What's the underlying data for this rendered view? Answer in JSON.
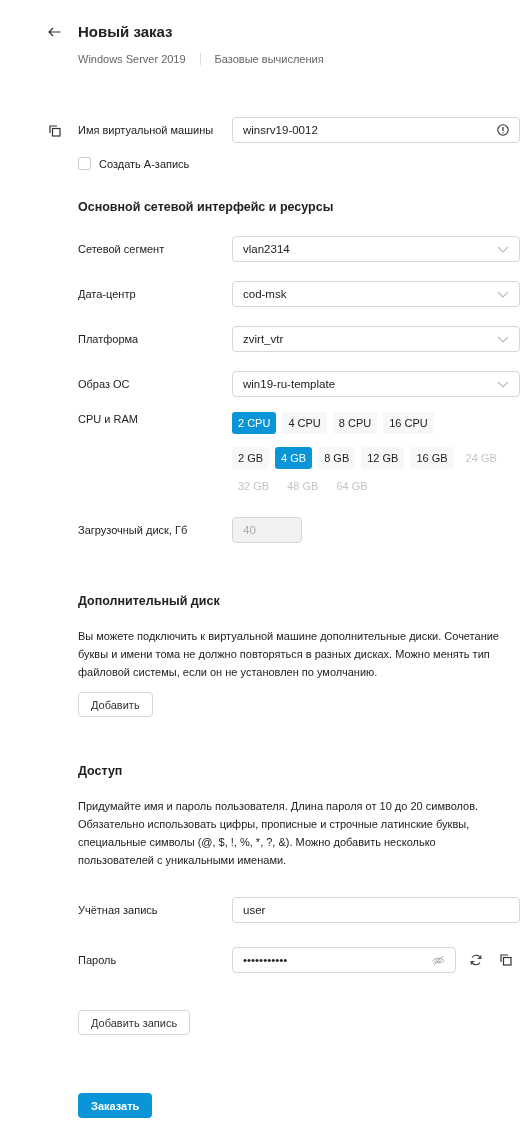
{
  "header": {
    "title": "Новый заказ",
    "subtitle": [
      "Windows Server 2019",
      "Базовые вычисления"
    ]
  },
  "vm_name": {
    "label": "Имя виртуальной машины",
    "value": "winsrv19-0012"
  },
  "a_record": {
    "label": "Создать А-запись",
    "checked": false
  },
  "network": {
    "heading": "Основной сетевой интерфейс и ресурсы",
    "selects": [
      {
        "label": "Сетевой сегмент",
        "value": "vlan2314"
      },
      {
        "label": "Дата-центр",
        "value": "cod-msk"
      },
      {
        "label": "Платформа",
        "value": "zvirt_vtr"
      },
      {
        "label": "Образ ОС",
        "value": "win19-ru-template"
      }
    ],
    "cpu_ram": {
      "label": "CPU и RAM",
      "cpu": [
        {
          "label": "2 CPU",
          "selected": true,
          "disabled": false
        },
        {
          "label": "4 CPU",
          "selected": false,
          "disabled": false
        },
        {
          "label": "8 CPU",
          "selected": false,
          "disabled": false
        },
        {
          "label": "16 CPU",
          "selected": false,
          "disabled": false
        }
      ],
      "ram": [
        {
          "label": "2 GB",
          "selected": false,
          "disabled": false
        },
        {
          "label": "4 GB",
          "selected": true,
          "disabled": false
        },
        {
          "label": "8 GB",
          "selected": false,
          "disabled": false
        },
        {
          "label": "12 GB",
          "selected": false,
          "disabled": false
        },
        {
          "label": "16 GB",
          "selected": false,
          "disabled": false
        },
        {
          "label": "24 GB",
          "selected": false,
          "disabled": true
        },
        {
          "label": "32 GB",
          "selected": false,
          "disabled": true
        },
        {
          "label": "48 GB",
          "selected": false,
          "disabled": true
        },
        {
          "label": "64 GB",
          "selected": false,
          "disabled": true
        }
      ]
    },
    "boot_disk": {
      "label": "Загрузочный диск, Гб",
      "value": "40",
      "disabled": true
    }
  },
  "extra_disk": {
    "heading": "Дополнительный диск",
    "text": "Вы можете подключить к виртуальной машине дополнительные диски. Сочетание буквы и имени тома не должно повторяться в разных дисках. Можно менять тип файловой системы, если он не установлен по умолчанию.",
    "button": "Добавить"
  },
  "access": {
    "heading": "Доступ",
    "text": "Придумайте имя и пароль пользователя. Длина пароля от 10 до 20 символов. Обязательно использовать цифры, прописные и строчные латинские буквы, специальные символы (@, $, !, %, *, ?, &). Можно добавить несколько пользователей с уникальными именами.",
    "account": {
      "label": "Учётная запись",
      "value": "user"
    },
    "password": {
      "label": "Пароль",
      "value": "•••••••••••"
    },
    "add_button": "Добавить запись"
  },
  "submit": "Заказать"
}
